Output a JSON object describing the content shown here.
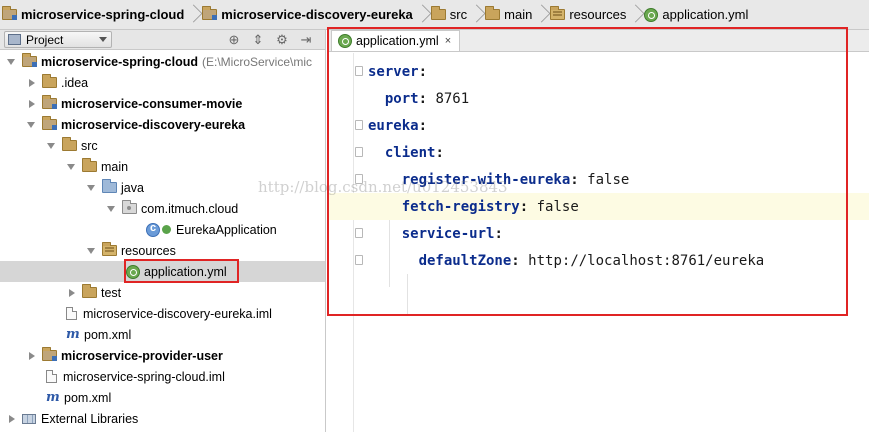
{
  "breadcrumb": {
    "items": [
      {
        "label": "microservice-spring-cloud",
        "icon": "module-folder-icon",
        "bold": true
      },
      {
        "label": "microservice-discovery-eureka",
        "icon": "module-folder-icon",
        "bold": true
      },
      {
        "label": "src",
        "icon": "folder-icon",
        "bold": false
      },
      {
        "label": "main",
        "icon": "folder-icon",
        "bold": false
      },
      {
        "label": "resources",
        "icon": "resources-folder-icon",
        "bold": false
      },
      {
        "label": "application.yml",
        "icon": "spring-yml-icon",
        "bold": false
      }
    ]
  },
  "project_panel": {
    "view_selector": "Project",
    "tree": [
      {
        "label": "microservice-spring-cloud",
        "path": "(E:\\MicroService\\mic",
        "bold": true,
        "icon": "module-folder-icon",
        "expanded": true
      },
      {
        "label": ".idea",
        "icon": "folder-icon",
        "expanded": false
      },
      {
        "label": "microservice-consumer-movie",
        "bold": true,
        "icon": "module-folder-icon",
        "expanded": false
      },
      {
        "label": "microservice-discovery-eureka",
        "bold": true,
        "icon": "module-folder-icon",
        "expanded": true
      },
      {
        "label": "src",
        "icon": "folder-icon",
        "expanded": true
      },
      {
        "label": "main",
        "icon": "folder-icon",
        "expanded": true
      },
      {
        "label": "java",
        "icon": "source-folder-icon",
        "expanded": true
      },
      {
        "label": "com.itmuch.cloud",
        "icon": "package-icon",
        "expanded": true
      },
      {
        "label": "EurekaApplication",
        "icon": "spring-boot-class-icon"
      },
      {
        "label": "resources",
        "icon": "resources-folder-icon",
        "expanded": true
      },
      {
        "label": "application.yml",
        "icon": "spring-yml-icon",
        "selected": true
      },
      {
        "label": "test",
        "icon": "folder-icon",
        "expanded": false
      },
      {
        "label": "microservice-discovery-eureka.iml",
        "icon": "iml-file-icon"
      },
      {
        "label": "pom.xml",
        "icon": "maven-pom-icon"
      },
      {
        "label": "microservice-provider-user",
        "bold": true,
        "icon": "module-folder-icon",
        "expanded": false
      },
      {
        "label": "microservice-spring-cloud.iml",
        "icon": "iml-file-icon"
      },
      {
        "label": "pom.xml",
        "icon": "maven-pom-icon"
      },
      {
        "label": "External Libraries",
        "icon": "library-icon",
        "expanded": false
      }
    ]
  },
  "editor": {
    "tab": {
      "label": "application.yml",
      "close": "×"
    },
    "lines": [
      {
        "indent": "",
        "key": "server",
        "value": ""
      },
      {
        "indent": "  ",
        "key": "port",
        "value": "8761"
      },
      {
        "indent": "",
        "key": "eureka",
        "value": ""
      },
      {
        "indent": "  ",
        "key": "client",
        "value": ""
      },
      {
        "indent": "    ",
        "key": "register-with-eureka",
        "value": "false"
      },
      {
        "indent": "    ",
        "key": "fetch-registry",
        "value": "false"
      },
      {
        "indent": "    ",
        "key": "service-url",
        "value": ""
      },
      {
        "indent": "      ",
        "key": "defaultZone",
        "value": "http://localhost:8761/eureka"
      }
    ]
  },
  "watermark": "http://blog.csdn.net/u012453843",
  "colors": {
    "highlight_box": "#e02424",
    "yaml_key": "#0b2c8c",
    "current_line": "#fdfbe3"
  }
}
